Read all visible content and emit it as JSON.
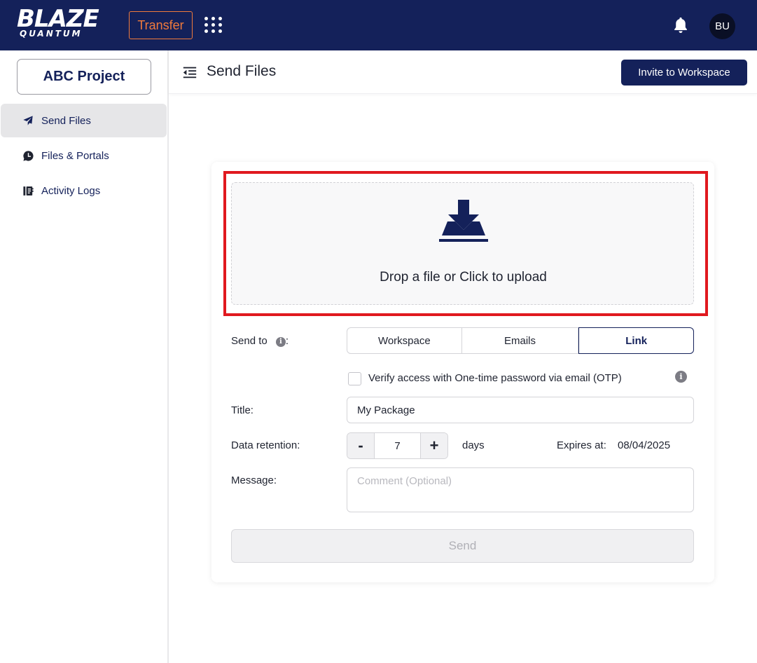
{
  "app": {
    "logo_line1": "BLAZE",
    "logo_line2": "QUANTUM",
    "transfer_label": "Transfer",
    "avatar_initials": "BU",
    "icons": {
      "apps": "apps-grid-icon",
      "notifications": "bell-icon"
    }
  },
  "sidebar": {
    "project": "ABC Project",
    "items": [
      {
        "label": "Send Files",
        "icon": "paper-plane-icon",
        "active": true
      },
      {
        "label": "Files & Portals",
        "icon": "clock-chat-icon",
        "active": false
      },
      {
        "label": "Activity Logs",
        "icon": "log-book-icon",
        "active": false
      }
    ]
  },
  "header": {
    "title": "Send Files",
    "invite_label": "Invite to Workspace"
  },
  "upload": {
    "drop_text": "Drop a file or Click to upload",
    "icon": "download-tray-icon"
  },
  "form": {
    "send_to_label": "Send to",
    "send_to_colon": ":",
    "send_to_options": [
      "Workspace",
      "Emails",
      "Link"
    ],
    "send_to_selected": "Link",
    "otp_label": "Verify access with One-time password via email (OTP)",
    "otp_checked": false,
    "title_label": "Title:",
    "title_value": "My Package",
    "retention_label": "Data retention:",
    "retention_minus": "-",
    "retention_plus": "+",
    "retention_value": "7",
    "retention_unit": "days",
    "expires_label": "Expires at:",
    "expires_value": "08/04/2025",
    "message_label": "Message:",
    "message_placeholder": "Comment (Optional)",
    "send_label": "Send"
  },
  "colors": {
    "brand_navy": "#14215a",
    "accent_orange": "#f07a3c",
    "highlight_red": "#e0191f"
  }
}
